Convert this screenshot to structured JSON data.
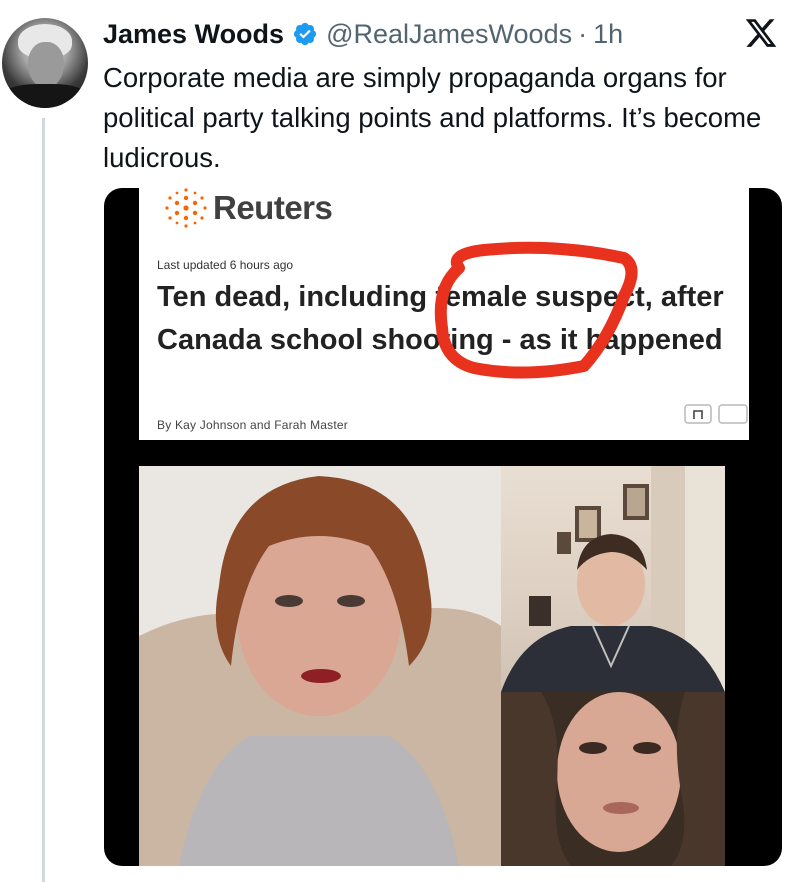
{
  "author": {
    "name": "James Woods",
    "handle": "@RealJamesWoods",
    "separator": "·",
    "time": "1h",
    "verified": true,
    "avatar_icon": "profile-photo"
  },
  "platform_icon": "x-logo-icon",
  "tweet": {
    "text": "Corporate media are simply propaganda organs for political party talking points and platforms. It’s become ludicrous."
  },
  "media": {
    "article": {
      "publisher": "Reuters",
      "last_updated": "Last updated 6 hours ago",
      "headline": "Ten dead, including female suspect, after Canada school shooting - as it happened",
      "byline": "By Kay Johnson and Farah Master"
    },
    "annotation_color": "#e8321e",
    "photos": [
      "photo-left",
      "photo-right-top",
      "photo-right-bottom"
    ]
  },
  "colors": {
    "verified_blue": "#1d9bf0",
    "reuters_orange": "#fa6400",
    "text_primary": "#0f1419",
    "text_secondary": "#536471"
  }
}
